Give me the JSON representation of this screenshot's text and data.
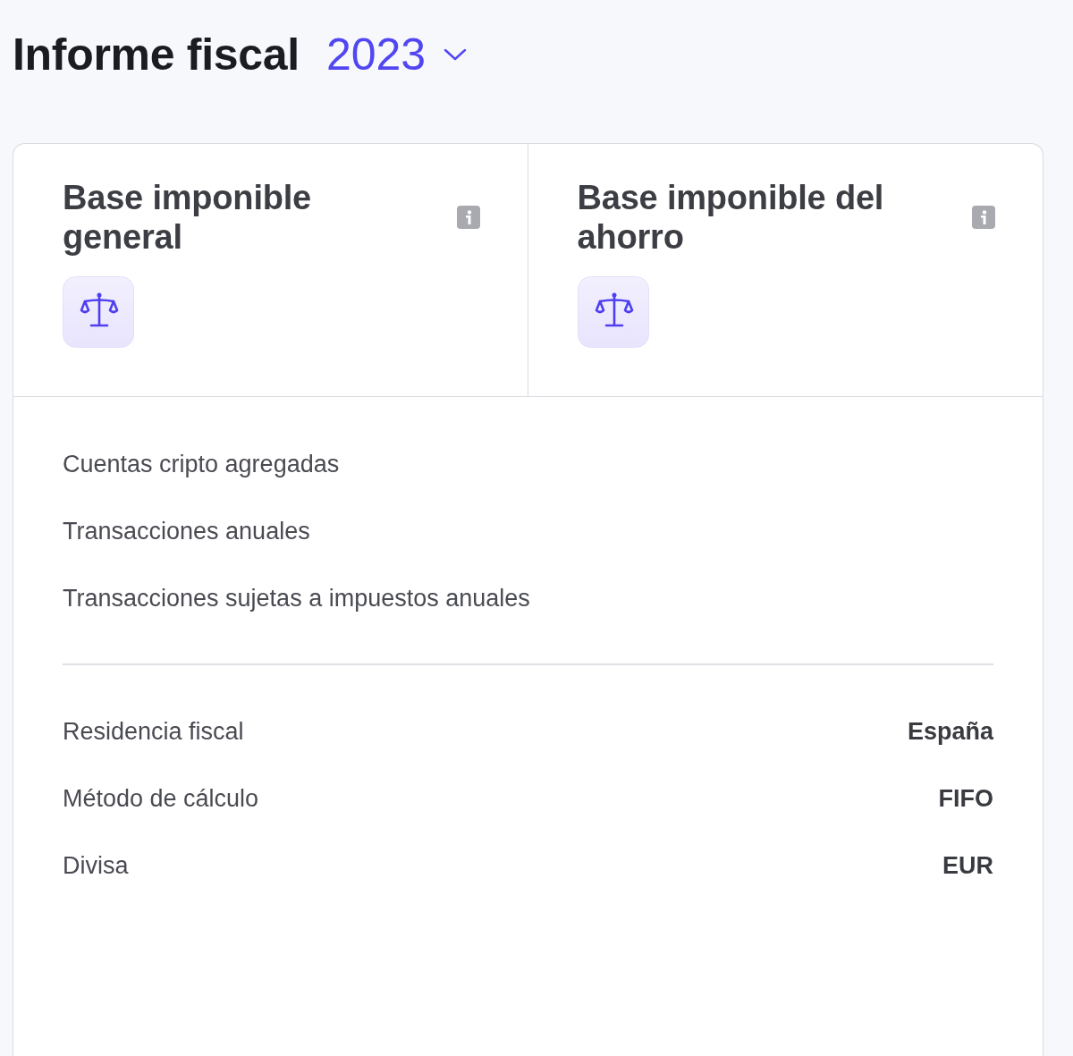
{
  "header": {
    "title": "Informe fiscal",
    "year_dropdown": {
      "value": "2023"
    }
  },
  "tax_bases": [
    {
      "title": "Base imponible general"
    },
    {
      "title": "Base imponible del ahorro"
    }
  ],
  "stats": [
    {
      "label": "Cuentas cripto agregadas"
    },
    {
      "label": "Transacciones anuales"
    },
    {
      "label": "Transacciones sujetas a impuestos anuales"
    }
  ],
  "settings": [
    {
      "label": "Residencia fiscal",
      "value": "España"
    },
    {
      "label": "Método de cálculo",
      "value": "FIFO"
    },
    {
      "label": "Divisa",
      "value": "EUR"
    }
  ]
}
